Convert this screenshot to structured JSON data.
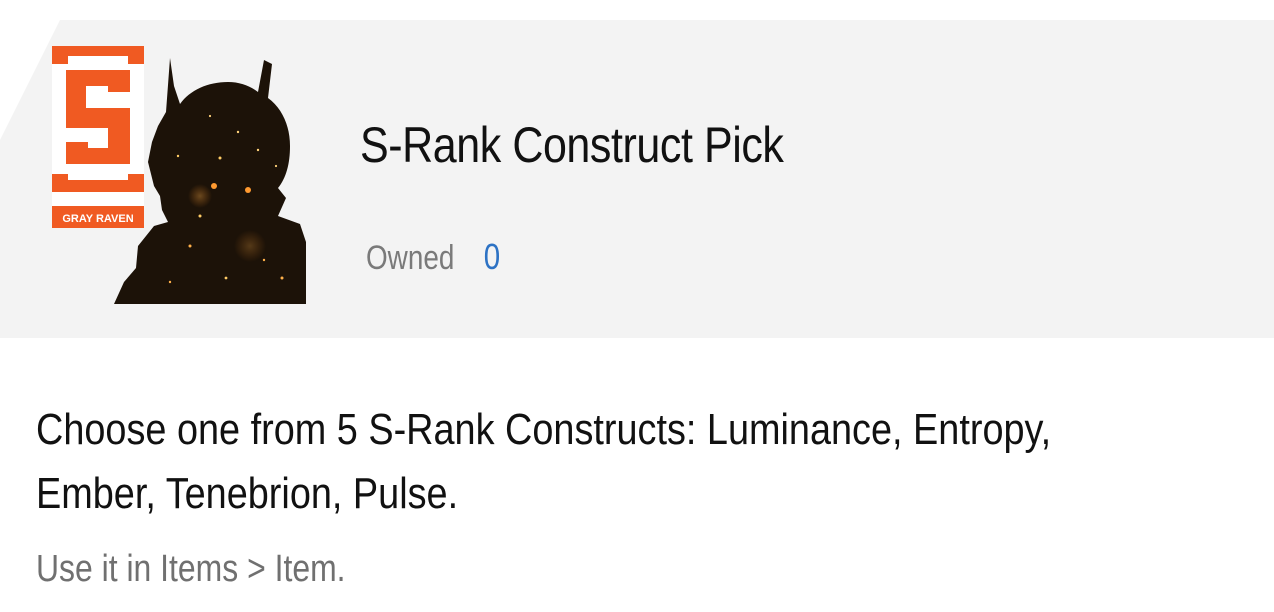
{
  "item": {
    "title": "S-Rank Construct Pick",
    "owned_label": "Owned",
    "owned_count": "0",
    "badge_text": "GRAY RAVEN",
    "badge_letter": "S"
  },
  "description": {
    "text": "Choose one from 5 S-Rank Constructs: Luminance, Entropy, Ember, Tenebrion, Pulse.",
    "hint": "Use it in Items > Item."
  },
  "colors": {
    "panel_bg": "#f3f3f3",
    "badge_orange": "#f05a22",
    "owned_count": "#2d72c4",
    "title_text": "#111111",
    "muted_text": "#7a7a7a"
  },
  "icons": {
    "item_icon": "construct-silhouette-icon",
    "badge_icon": "gray-raven-s-rank-badge-icon"
  }
}
